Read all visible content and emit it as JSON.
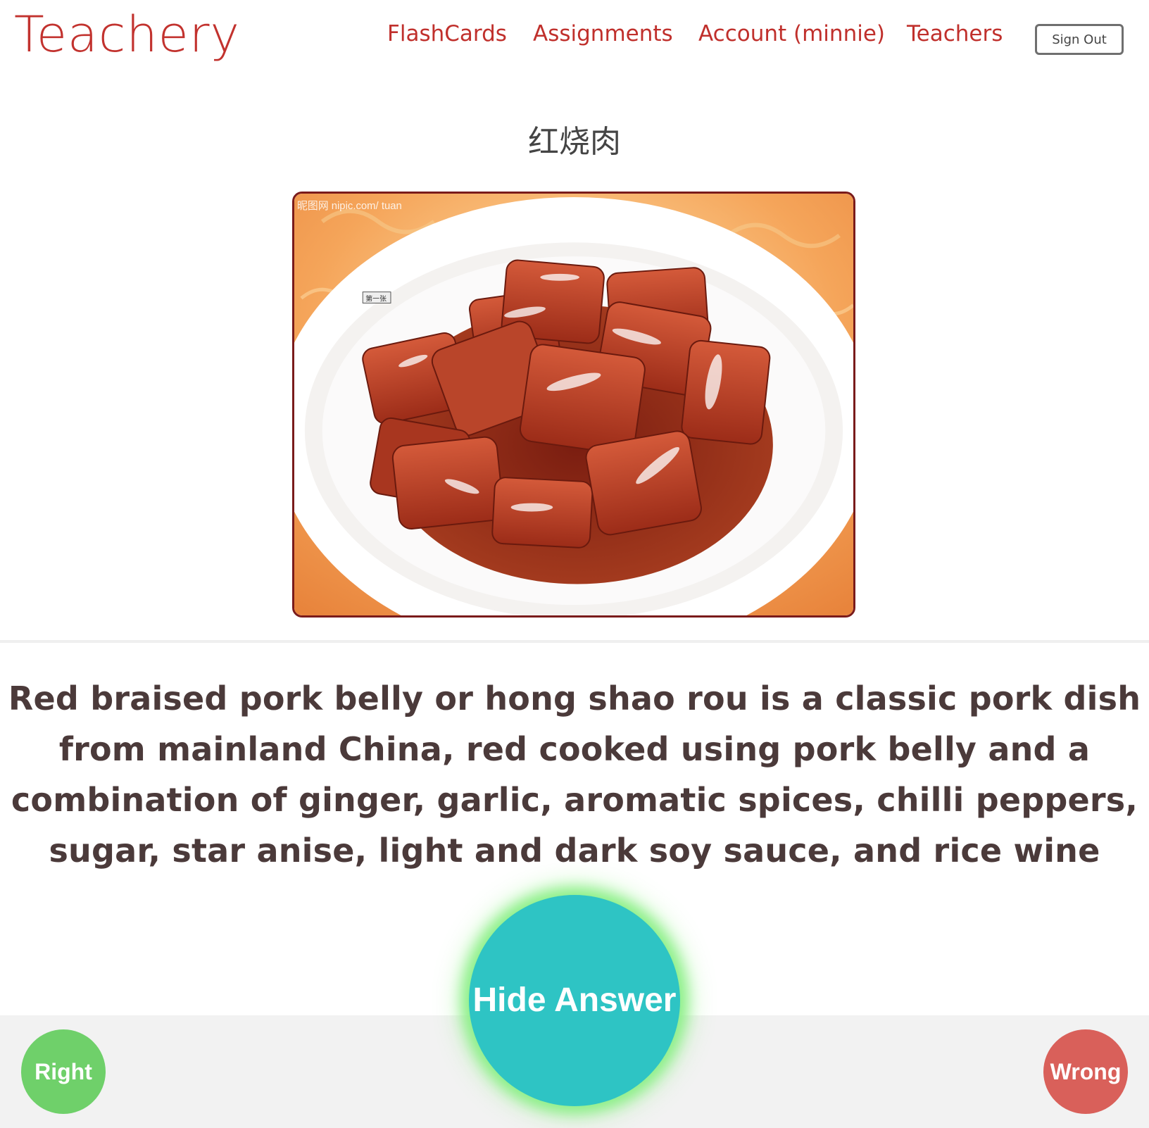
{
  "header": {
    "brand": "Teachery",
    "nav": [
      {
        "label": "FlashCards"
      },
      {
        "label": "Assignments"
      },
      {
        "label": "Account (minnie)"
      },
      {
        "label": "Teachers"
      }
    ],
    "sign_out_label": "Sign Out"
  },
  "card": {
    "title": "红烧肉",
    "image": {
      "watermark": "昵图网 nipic.com/ tuan",
      "stamp": "第一张"
    },
    "answer": "Red braised pork belly or hong shao rou is a classic pork dish from mainland China, red cooked using pork belly and a combination of ginger, garlic, aromatic spices, chilli peppers, sugar, star anise, light and dark soy sauce, and rice wine"
  },
  "controls": {
    "hide_answer_label": "Hide Answer",
    "right_label": "Right",
    "wrong_label": "Wrong"
  },
  "colors": {
    "brand_red": "#c2322e",
    "hide_button_teal": "#2ec4c4",
    "right_green": "#6fd06a",
    "wrong_red": "#d9605a",
    "answer_text": "#4b3a3a"
  }
}
